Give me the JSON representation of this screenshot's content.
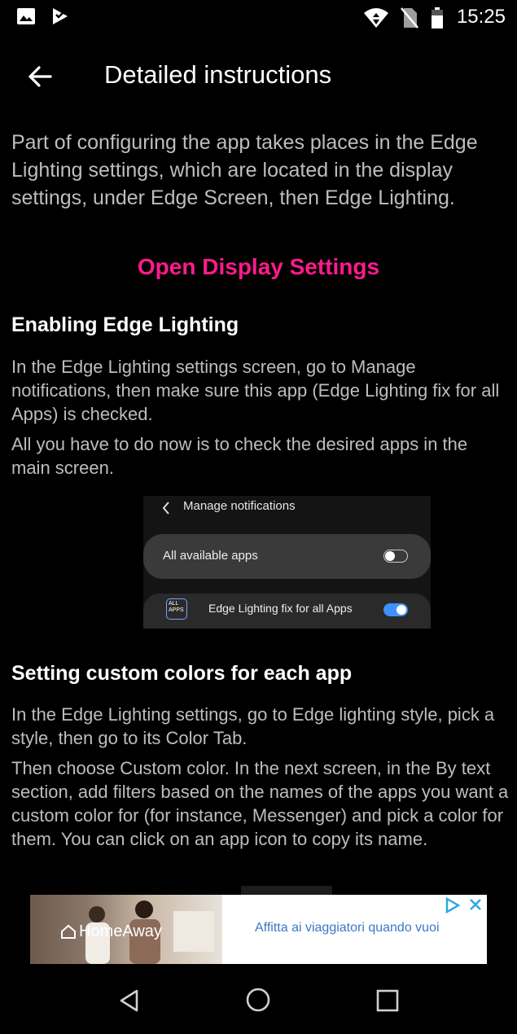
{
  "status_bar": {
    "time": "15:25",
    "left_icons": [
      "gallery-icon",
      "play-store-icon"
    ],
    "right_icons": [
      "wifi-icon",
      "no-sim-icon",
      "battery-icon"
    ]
  },
  "app_bar": {
    "title": "Detailed instructions",
    "back_icon": "back-arrow-icon"
  },
  "content": {
    "intro": "Part of configuring the app takes places in the Edge Lighting settings, which are located in the display settings, under Edge Screen, then Edge Lighting.",
    "open_link": "Open Display Settings",
    "section1": {
      "heading": "Enabling Edge Lighting",
      "p1": "In the Edge Lighting settings screen, go to Manage notifications, then make sure this app (Edge Lighting fix for all Apps) is checked.",
      "p2": "All you have to do now is to check the desired apps in the main screen."
    },
    "screenshot": {
      "header": "Manage notifications",
      "row1_label": "All available apps",
      "row1_toggle": false,
      "row2_label": "Edge Lighting fix for all Apps",
      "row2_toggle": true,
      "row2_icon_text": "ALL APPS"
    },
    "section2": {
      "heading": "Setting custom colors for each app",
      "p1": "In the Edge Lighting settings, go to Edge lighting style, pick a style, then go to its Color Tab.",
      "p2": "Then choose Custom color. In the next screen, in the By text section, add filters based on the names of the apps you want a custom color for (for instance, Messenger) and pick a color for them. You can click on an app icon to copy its name."
    }
  },
  "ad": {
    "brand": "HomeAway",
    "text": "Affitta ai viaggiatori quando vuoi",
    "accent": "#3b78c5"
  },
  "nav_bar": {
    "buttons": [
      "back-triangle-icon",
      "home-circle-icon",
      "recents-square-icon"
    ]
  },
  "colors": {
    "background": "#000000",
    "link": "#ff1a8c",
    "toggle_on": "#3e91ff"
  }
}
